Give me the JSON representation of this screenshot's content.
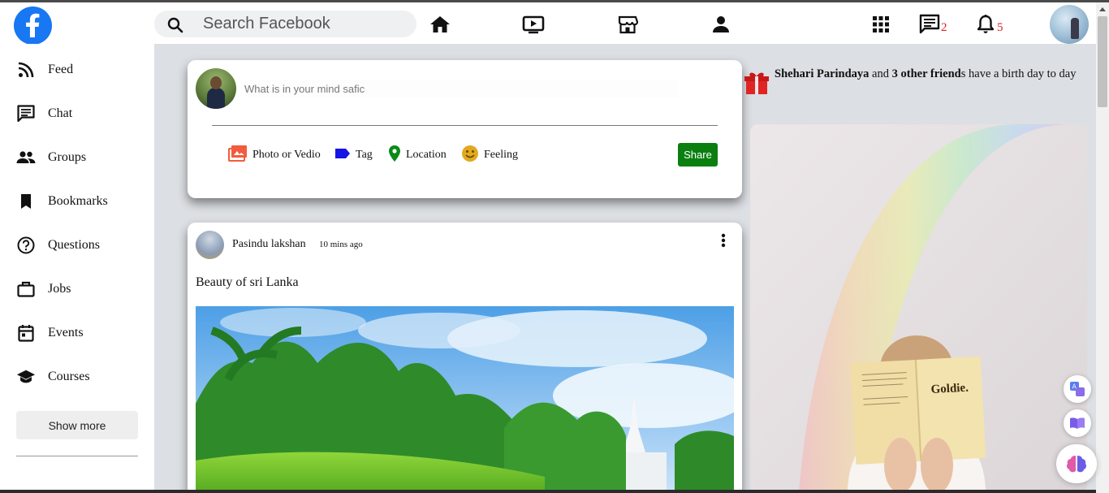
{
  "header": {
    "search_placeholder": "Search Facebook",
    "messages_badge": "2",
    "notifications_badge": "5"
  },
  "sidebar": {
    "items": [
      {
        "label": "Feed",
        "icon": "rss-icon"
      },
      {
        "label": "Chat",
        "icon": "chat-icon"
      },
      {
        "label": "Groups",
        "icon": "groups-icon"
      },
      {
        "label": "Bookmarks",
        "icon": "bookmark-icon"
      },
      {
        "label": "Questions",
        "icon": "help-icon"
      },
      {
        "label": "Jobs",
        "icon": "briefcase-icon"
      },
      {
        "label": "Events",
        "icon": "calendar-icon"
      },
      {
        "label": "Courses",
        "icon": "school-icon"
      }
    ],
    "show_more": "Show more"
  },
  "composer": {
    "placeholder": "What is in your mind safic",
    "actions": {
      "photo": "Photo or Vedio",
      "tag": "Tag",
      "location": "Location",
      "feeling": "Feeling"
    },
    "share": "Share"
  },
  "post": {
    "author": "Pasindu lakshan",
    "time": "10 mins ago",
    "caption": "Beauty of sri Lanka"
  },
  "birthday": {
    "name": "Shehari Parindaya",
    "and": " and ",
    "others": "3 other friend",
    "rest": "s have a birth day to day"
  },
  "ad": {
    "book_title": "Goldie."
  },
  "colors": {
    "brand": "#1877f2",
    "share": "#0a7f10",
    "badge": "#e02020",
    "main_bg": "#dcdfe3"
  }
}
